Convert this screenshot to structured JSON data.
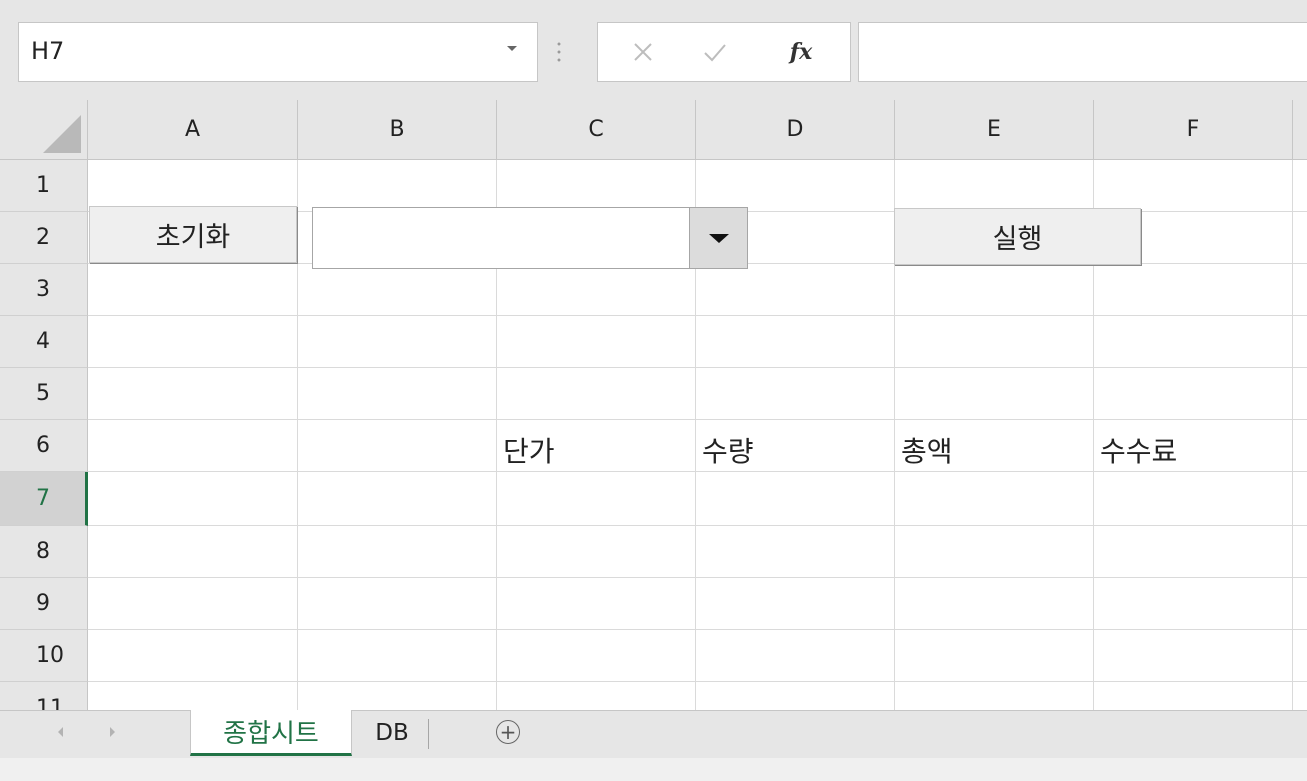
{
  "name_box": {
    "value": "H7"
  },
  "formula_bar": {
    "value": "",
    "fx_label": "fx"
  },
  "columns": [
    "A",
    "B",
    "C",
    "D",
    "E",
    "F"
  ],
  "rows": [
    "1",
    "2",
    "3",
    "4",
    "5",
    "6",
    "7",
    "8",
    "9",
    "10"
  ],
  "partial_row": "11",
  "active_row": "7",
  "cells": {
    "C6": "단가",
    "D6": "수량",
    "E6": "총액",
    "F6": "수수료"
  },
  "controls": {
    "reset_button_label": "초기화",
    "run_button_label": "실행",
    "combo_value": ""
  },
  "sheet_tabs": [
    {
      "label": "종합시트",
      "active": true
    },
    {
      "label": "DB",
      "active": false
    }
  ],
  "add_sheet_symbol": "+",
  "accent_color": "#217346"
}
